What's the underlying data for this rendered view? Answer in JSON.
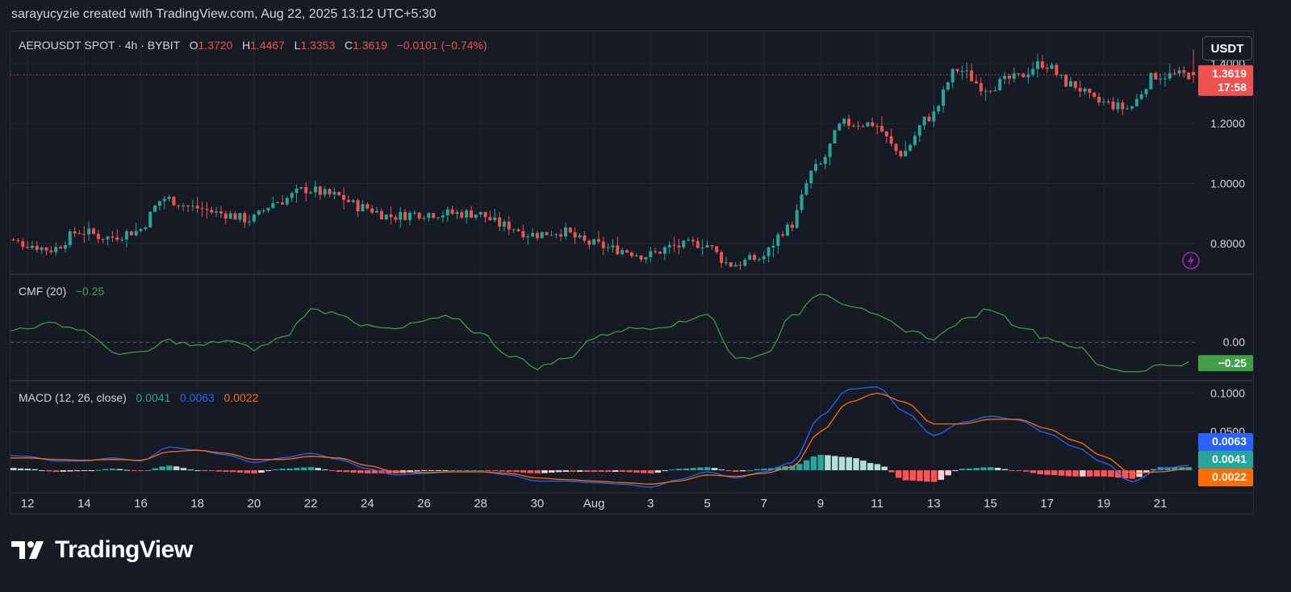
{
  "header": {
    "text": "sarayucyzie created with TradingView.com, Aug 22, 2025 13:12 UTC+5:30"
  },
  "price_pane": {
    "symbol": "AEROUSDT SPOT · 4h · BYBIT",
    "o_label": "O",
    "o_value": "1.3720",
    "h_label": "H",
    "h_value": "1.4467",
    "l_label": "L",
    "l_value": "1.3353",
    "c_label": "C",
    "c_value": "1.3619",
    "change": "−0.0101 (−0.74%)",
    "currency": "USDT",
    "last_price": "1.3619",
    "countdown": "17:58",
    "axis_ticks": [
      "1.4000",
      "1.2000",
      "1.0000",
      "0.8000"
    ]
  },
  "cmf_pane": {
    "label": "CMF (20)",
    "value": "−0.25",
    "axis_ticks": [
      "0.00"
    ],
    "badge": "−0.25"
  },
  "macd_pane": {
    "label": "MACD (12, 26, close)",
    "hist_value": "0.0041",
    "macd_value": "0.0063",
    "signal_value": "0.0022",
    "axis_ticks": [
      "0.1000",
      "0.0500"
    ],
    "badges": [
      "0.0063",
      "0.0041",
      "0.0022"
    ]
  },
  "x_axis": {
    "labels": [
      "12",
      "14",
      "16",
      "18",
      "20",
      "22",
      "24",
      "26",
      "28",
      "30",
      "Aug",
      "3",
      "5",
      "7",
      "9",
      "11",
      "13",
      "15",
      "17",
      "19",
      "21"
    ]
  },
  "footer": {
    "brand": "TradingView"
  },
  "colors": {
    "up": "#26a69a",
    "down": "#ef5350",
    "background": "#161a25",
    "grid": "#232733",
    "cmf_line": "#43a047",
    "macd_line": "#2962ff",
    "signal_line": "#ff6d00",
    "hist_up_strong": "#26a69a",
    "hist_up_weak": "#b2dfdb",
    "hist_down_strong": "#ff5252",
    "hist_down_weak": "#ffcdd2"
  },
  "chart_data": [
    {
      "type": "candlestick",
      "interval": "4h",
      "ylim": [
        0.7,
        1.48
      ],
      "x_range": [
        "Jul 11",
        "Aug 22"
      ],
      "close_anchors": [
        [
          "Jul 11",
          0.82
        ],
        [
          "Jul 12",
          0.8
        ],
        [
          "Jul 13",
          0.78
        ],
        [
          "Jul 14",
          0.84
        ],
        [
          "Jul 15",
          0.82
        ],
        [
          "Jul 16",
          0.84
        ],
        [
          "Jul 17",
          0.95
        ],
        [
          "Jul 18",
          0.92
        ],
        [
          "Jul 19",
          0.9
        ],
        [
          "Jul 20",
          0.88
        ],
        [
          "Jul 21",
          0.94
        ],
        [
          "Jul 22",
          0.98
        ],
        [
          "Jul 23",
          0.96
        ],
        [
          "Jul 24",
          0.92
        ],
        [
          "Jul 25",
          0.89
        ],
        [
          "Jul 26",
          0.9
        ],
        [
          "Jul 27",
          0.9
        ],
        [
          "Jul 28",
          0.9
        ],
        [
          "Jul 29",
          0.86
        ],
        [
          "Jul 30",
          0.83
        ],
        [
          "Jul 31",
          0.84
        ],
        [
          "Aug 1",
          0.8
        ],
        [
          "Aug 2",
          0.78
        ],
        [
          "Aug 3",
          0.76
        ],
        [
          "Aug 4",
          0.79
        ],
        [
          "Aug 5",
          0.8
        ],
        [
          "Aug 6",
          0.73
        ],
        [
          "Aug 7",
          0.75
        ],
        [
          "Aug 8",
          0.85
        ],
        [
          "Aug 9",
          1.05
        ],
        [
          "Aug 10",
          1.2
        ],
        [
          "Aug 11",
          1.2
        ],
        [
          "Aug 12",
          1.1
        ],
        [
          "Aug 13",
          1.22
        ],
        [
          "Aug 14",
          1.38
        ],
        [
          "Aug 15",
          1.32
        ],
        [
          "Aug 16",
          1.35
        ],
        [
          "Aug 17",
          1.4
        ],
        [
          "Aug 18",
          1.33
        ],
        [
          "Aug 19",
          1.27
        ],
        [
          "Aug 20",
          1.25
        ],
        [
          "Aug 21",
          1.36
        ],
        [
          "Aug 22",
          1.3619
        ]
      ],
      "last": {
        "open": 1.372,
        "high": 1.4467,
        "low": 1.3353,
        "close": 1.3619
      }
    },
    {
      "type": "line",
      "name": "CMF (20)",
      "ylim": [
        -0.45,
        0.8
      ],
      "points": [
        [
          "Jul 11",
          0.1
        ],
        [
          "Jul 12",
          0.18
        ],
        [
          "Jul 13",
          0.22
        ],
        [
          "Jul 14",
          0.14
        ],
        [
          "Jul 15",
          -0.12
        ],
        [
          "Jul 16",
          -0.14
        ],
        [
          "Jul 17",
          0.02
        ],
        [
          "Jul 18",
          -0.05
        ],
        [
          "Jul 19",
          0.02
        ],
        [
          "Jul 20",
          -0.08
        ],
        [
          "Jul 21",
          0.05
        ],
        [
          "Jul 22",
          0.38
        ],
        [
          "Jul 23",
          0.35
        ],
        [
          "Jul 24",
          0.18
        ],
        [
          "Jul 25",
          0.15
        ],
        [
          "Jul 26",
          0.25
        ],
        [
          "Jul 27",
          0.3
        ],
        [
          "Jul 28",
          0.1
        ],
        [
          "Jul 29",
          -0.15
        ],
        [
          "Jul 30",
          -0.3
        ],
        [
          "Jul 31",
          -0.2
        ],
        [
          "Aug 1",
          0.05
        ],
        [
          "Aug 2",
          0.15
        ],
        [
          "Aug 3",
          0.18
        ],
        [
          "Aug 4",
          0.22
        ],
        [
          "Aug 5",
          0.35
        ],
        [
          "Aug 6",
          -0.2
        ],
        [
          "Aug 7",
          -0.15
        ],
        [
          "Aug 8",
          0.3
        ],
        [
          "Aug 9",
          0.6
        ],
        [
          "Aug 10",
          0.45
        ],
        [
          "Aug 11",
          0.3
        ],
        [
          "Aug 12",
          0.15
        ],
        [
          "Aug 13",
          0.05
        ],
        [
          "Aug 14",
          0.25
        ],
        [
          "Aug 15",
          0.4
        ],
        [
          "Aug 16",
          0.2
        ],
        [
          "Aug 17",
          0.05
        ],
        [
          "Aug 18",
          -0.05
        ],
        [
          "Aug 19",
          -0.3
        ],
        [
          "Aug 20",
          -0.35
        ],
        [
          "Aug 21",
          -0.28
        ],
        [
          "Aug 22",
          -0.25
        ]
      ]
    },
    {
      "type": "line+bar",
      "name": "MACD (12, 26, close)",
      "ylim": [
        -0.025,
        0.115
      ],
      "macd": [
        [
          "Jul 11",
          0.02
        ],
        [
          "Jul 12",
          0.018
        ],
        [
          "Jul 13",
          0.012
        ],
        [
          "Jul 14",
          0.012
        ],
        [
          "Jul 15",
          0.016
        ],
        [
          "Jul 16",
          0.012
        ],
        [
          "Jul 17",
          0.03
        ],
        [
          "Jul 18",
          0.026
        ],
        [
          "Jul 19",
          0.02
        ],
        [
          "Jul 20",
          0.01
        ],
        [
          "Jul 21",
          0.016
        ],
        [
          "Jul 22",
          0.022
        ],
        [
          "Jul 23",
          0.014
        ],
        [
          "Jul 24",
          0.002
        ],
        [
          "Jul 25",
          -0.006
        ],
        [
          "Jul 26",
          -0.004
        ],
        [
          "Jul 27",
          -0.002
        ],
        [
          "Jul 28",
          -0.002
        ],
        [
          "Jul 29",
          -0.006
        ],
        [
          "Jul 30",
          -0.014
        ],
        [
          "Jul 31",
          -0.014
        ],
        [
          "Aug 1",
          -0.016
        ],
        [
          "Aug 2",
          -0.018
        ],
        [
          "Aug 3",
          -0.022
        ],
        [
          "Aug 4",
          -0.012
        ],
        [
          "Aug 5",
          -0.002
        ],
        [
          "Aug 6",
          -0.01
        ],
        [
          "Aug 7",
          -0.002
        ],
        [
          "Aug 8",
          0.01
        ],
        [
          "Aug 9",
          0.07
        ],
        [
          "Aug 10",
          0.105
        ],
        [
          "Aug 11",
          0.108
        ],
        [
          "Aug 12",
          0.075
        ],
        [
          "Aug 13",
          0.045
        ],
        [
          "Aug 14",
          0.062
        ],
        [
          "Aug 15",
          0.07
        ],
        [
          "Aug 16",
          0.065
        ],
        [
          "Aug 17",
          0.048
        ],
        [
          "Aug 18",
          0.03
        ],
        [
          "Aug 19",
          0.01
        ],
        [
          "Aug 20",
          -0.015
        ],
        [
          "Aug 21",
          0.002
        ],
        [
          "Aug 22",
          0.0063
        ]
      ],
      "signal": [
        [
          "Jul 11",
          0.016
        ],
        [
          "Jul 12",
          0.016
        ],
        [
          "Jul 13",
          0.014
        ],
        [
          "Jul 14",
          0.013
        ],
        [
          "Jul 15",
          0.014
        ],
        [
          "Jul 16",
          0.013
        ],
        [
          "Jul 17",
          0.024
        ],
        [
          "Jul 18",
          0.026
        ],
        [
          "Jul 19",
          0.022
        ],
        [
          "Jul 20",
          0.014
        ],
        [
          "Jul 21",
          0.014
        ],
        [
          "Jul 22",
          0.018
        ],
        [
          "Jul 23",
          0.016
        ],
        [
          "Jul 24",
          0.006
        ],
        [
          "Jul 25",
          -0.002
        ],
        [
          "Jul 26",
          -0.003
        ],
        [
          "Jul 27",
          -0.002
        ],
        [
          "Jul 28",
          -0.002
        ],
        [
          "Jul 29",
          -0.004
        ],
        [
          "Jul 30",
          -0.01
        ],
        [
          "Jul 31",
          -0.012
        ],
        [
          "Aug 1",
          -0.014
        ],
        [
          "Aug 2",
          -0.016
        ],
        [
          "Aug 3",
          -0.018
        ],
        [
          "Aug 4",
          -0.014
        ],
        [
          "Aug 5",
          -0.006
        ],
        [
          "Aug 6",
          -0.008
        ],
        [
          "Aug 7",
          -0.004
        ],
        [
          "Aug 8",
          0.004
        ],
        [
          "Aug 9",
          0.05
        ],
        [
          "Aug 10",
          0.088
        ],
        [
          "Aug 11",
          0.1
        ],
        [
          "Aug 12",
          0.088
        ],
        [
          "Aug 13",
          0.06
        ],
        [
          "Aug 14",
          0.06
        ],
        [
          "Aug 15",
          0.066
        ],
        [
          "Aug 16",
          0.066
        ],
        [
          "Aug 17",
          0.054
        ],
        [
          "Aug 18",
          0.038
        ],
        [
          "Aug 19",
          0.018
        ],
        [
          "Aug 20",
          -0.004
        ],
        [
          "Aug 21",
          -0.002
        ],
        [
          "Aug 22",
          0.0022
        ]
      ]
    }
  ]
}
